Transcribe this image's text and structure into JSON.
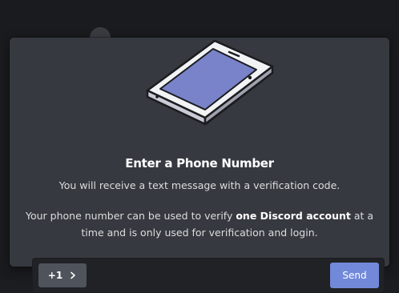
{
  "modal": {
    "title": "Enter a Phone Number",
    "subtitle": "You will receive a text message with a verification code.",
    "info_prefix": "Your phone number can be used to verify ",
    "info_bold": "one Discord account",
    "info_suffix": " at a time and is only used for verification and login."
  },
  "phone_form": {
    "country_code": "+1",
    "phone_value": "",
    "phone_placeholder": "",
    "send_label": "Send"
  },
  "icons": {
    "illustration": "phone-illustration",
    "country_chevron": "chevron-right-icon"
  },
  "colors": {
    "modal_bg": "#36393f",
    "input_bg": "#202225",
    "country_bg": "#4f545c",
    "send_bg": "#7289da",
    "phone_screen": "#7983c9"
  }
}
